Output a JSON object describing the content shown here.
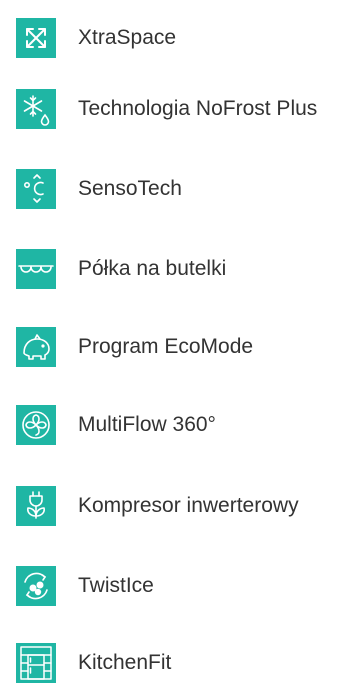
{
  "features": [
    {
      "label": "XtraSpace",
      "icon": "expand-arrows-icon"
    },
    {
      "label": "Technologia NoFrost Plus",
      "icon": "snowflake-drop-icon"
    },
    {
      "label": "SensoTech",
      "icon": "temperature-celsius-icon"
    },
    {
      "label": "Półka na butelki",
      "icon": "bottle-shelf-icon"
    },
    {
      "label": "Program EcoMode",
      "icon": "piggy-bank-icon"
    },
    {
      "label": "MultiFlow 360°",
      "icon": "airflow-fan-icon"
    },
    {
      "label": "Kompresor inwerterowy",
      "icon": "plug-leaf-icon"
    },
    {
      "label": "TwistIce",
      "icon": "ice-twist-icon"
    },
    {
      "label": "KitchenFit",
      "icon": "kitchen-fit-icon"
    }
  ],
  "colors": {
    "icon_background": "#1fb6a4",
    "icon_foreground": "#ffffff",
    "text": "#333333"
  }
}
